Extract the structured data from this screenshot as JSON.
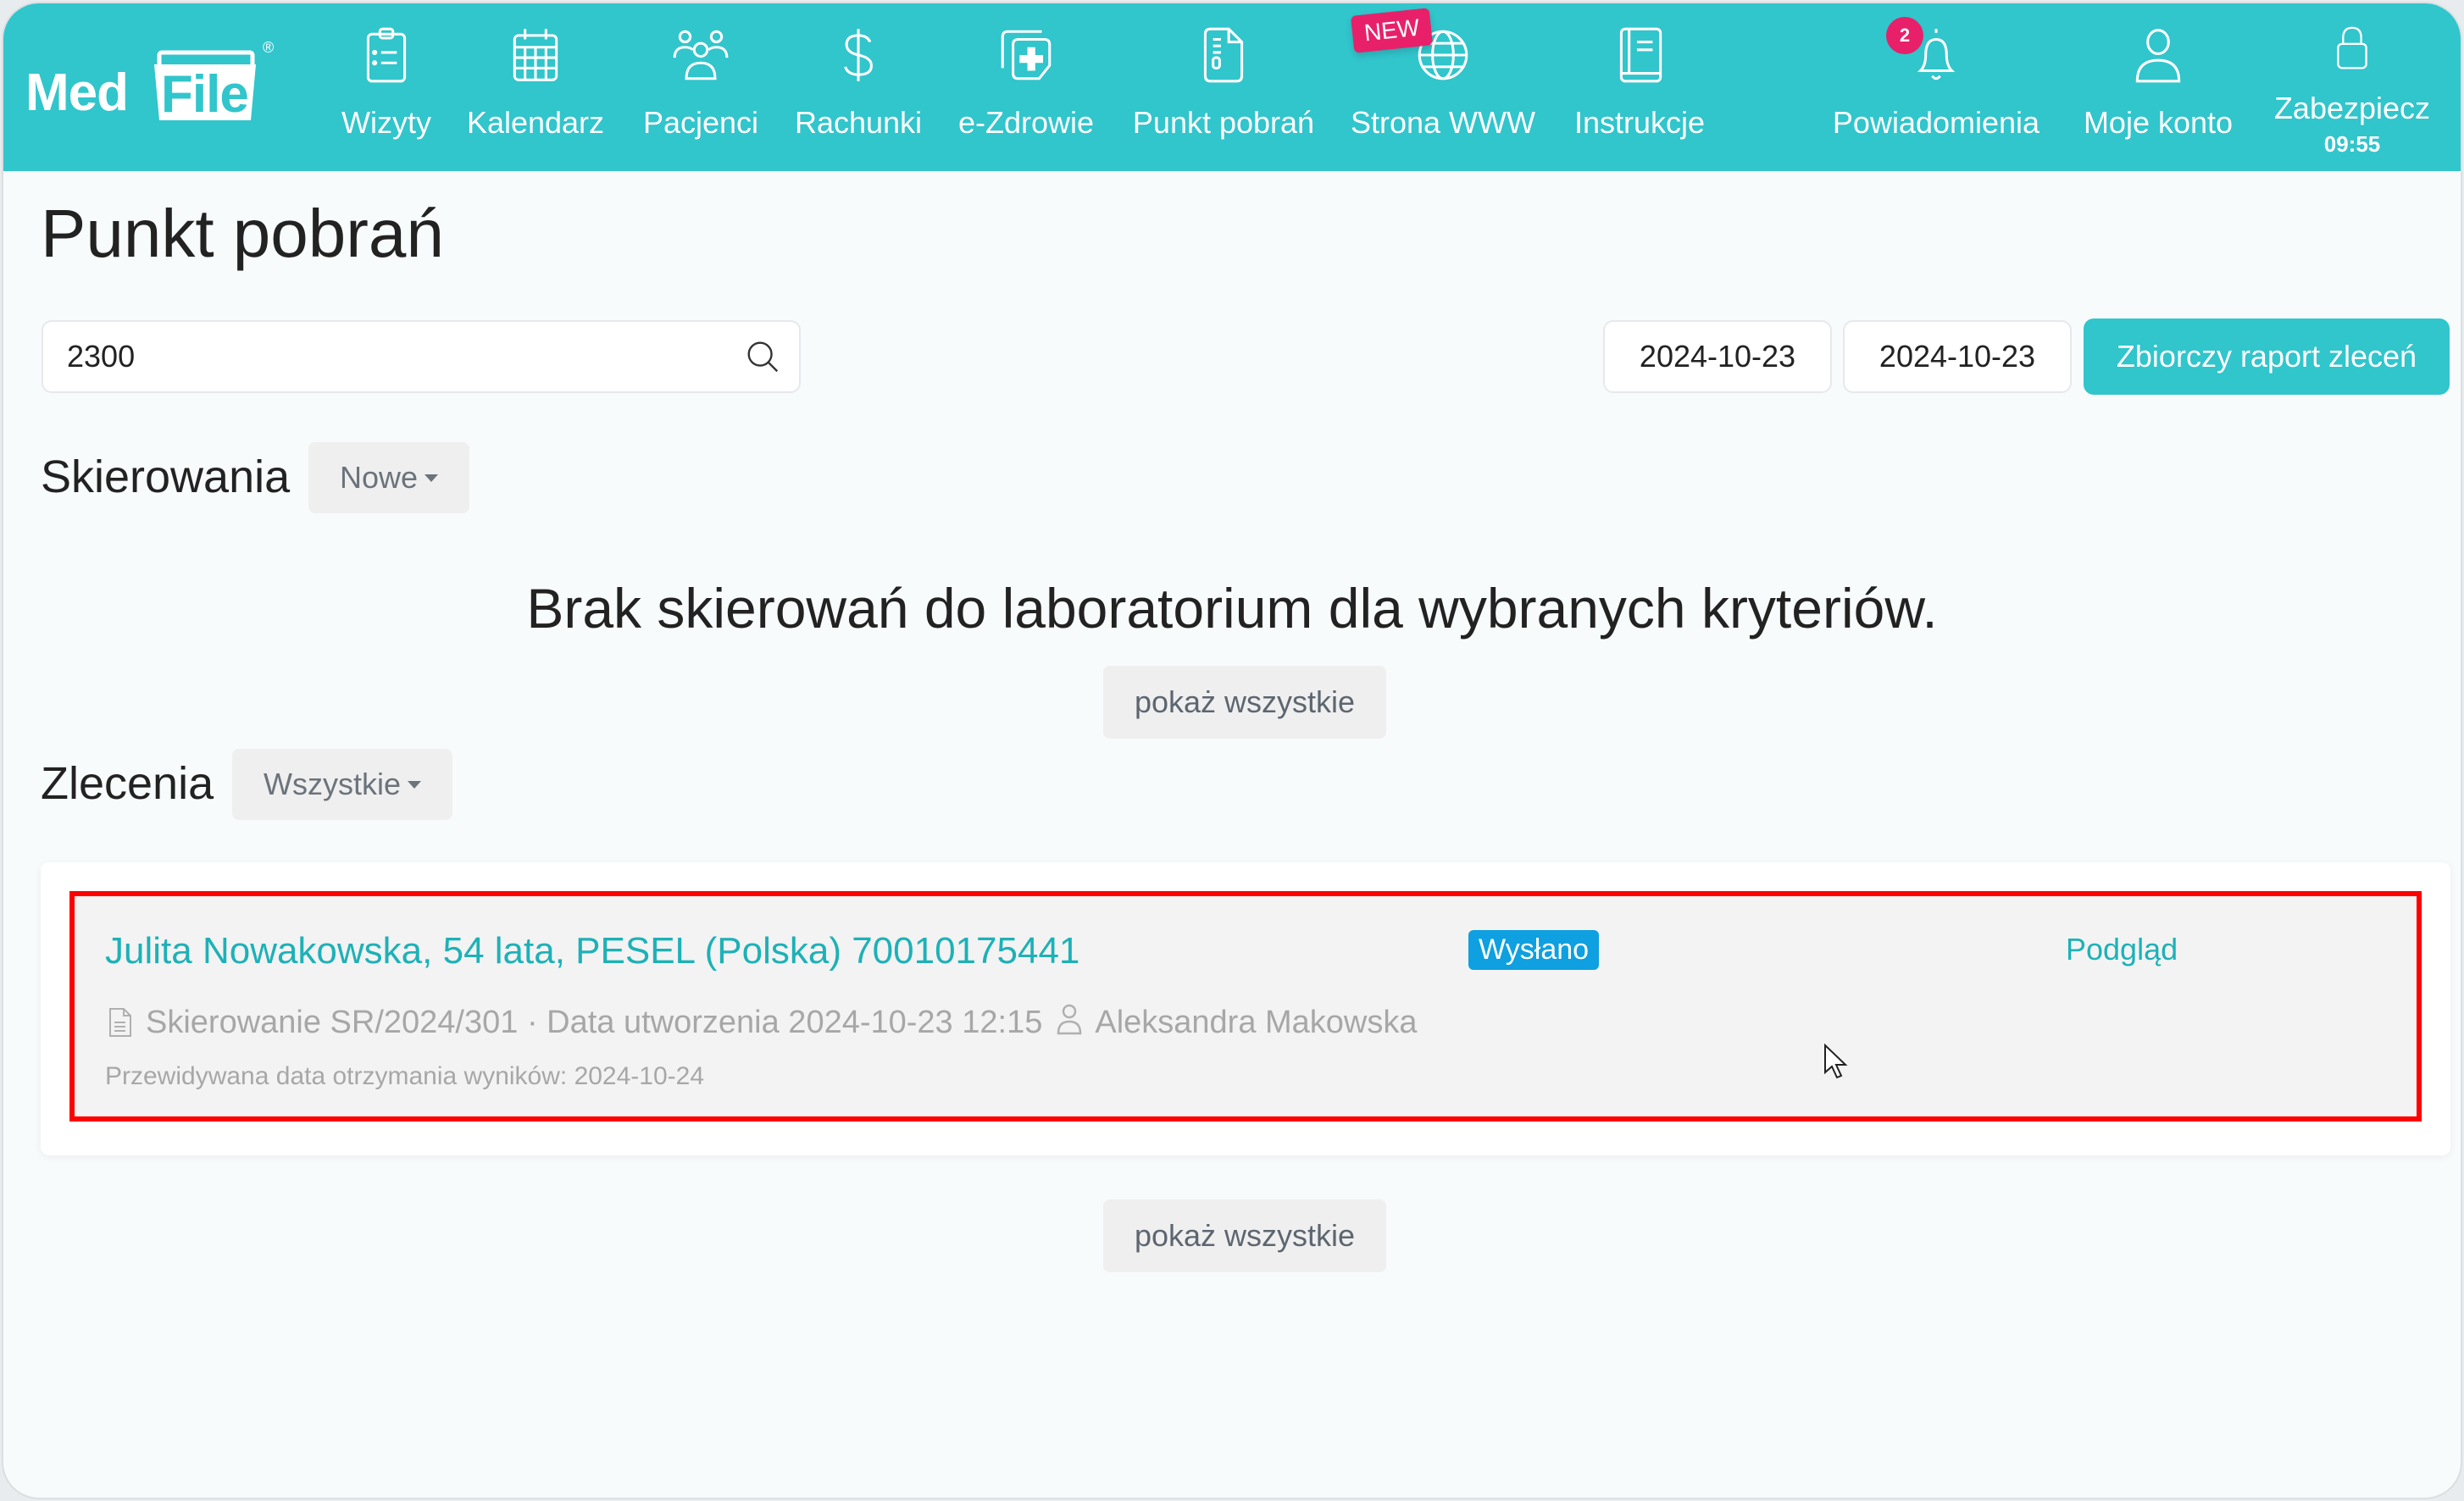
{
  "app": {
    "logo_left": "Med",
    "logo_right": "File",
    "logo_mark": "®"
  },
  "nav": {
    "items": [
      {
        "label": "Wizyty",
        "icon": "clipboard-icon"
      },
      {
        "label": "Kalendarz",
        "icon": "calendar-icon"
      },
      {
        "label": "Pacjenci",
        "icon": "patients-icon"
      },
      {
        "label": "Rachunki",
        "icon": "dollar-icon"
      },
      {
        "label": "e-Zdrowie",
        "icon": "ehealth-icon"
      },
      {
        "label": "Punkt pobrań",
        "icon": "sample-document-icon"
      },
      {
        "label": "Strona WWW",
        "icon": "globe-icon",
        "badge": "NEW"
      },
      {
        "label": "Instrukcje",
        "icon": "book-icon"
      },
      {
        "label": "Powiadomienia",
        "icon": "bell-icon",
        "count": "2"
      },
      {
        "label": "Moje konto",
        "icon": "user-icon"
      },
      {
        "label": "Zabezpiecz",
        "icon": "lock-icon",
        "timer": "09:55"
      }
    ]
  },
  "page": {
    "title": "Punkt pobrań"
  },
  "filters": {
    "search_value": "2300",
    "date_from": "2024-10-23",
    "date_to": "2024-10-23",
    "report_button": "Zbiorczy raport zleceń"
  },
  "referrals": {
    "title": "Skierowania",
    "filter_selected": "Nowe",
    "empty_message": "Brak skierowań do laboratorium dla wybranych kryteriów.",
    "show_all": "pokaż wszystkie"
  },
  "orders": {
    "title": "Zlecenia",
    "filter_selected": "Wszystkie",
    "show_all": "pokaż wszystkie",
    "items": [
      {
        "patient": "Julita Nowakowska, 54 lata, PESEL (Polska) 70010175441",
        "status": "Wysłano",
        "preview_link": "Podgląd",
        "referral": "Skierowanie SR/2024/301 · Data utworzenia 2024-10-23 12:15",
        "author": "Aleksandra Makowska",
        "expected_results": "Przewidywana data otrzymania wyników: 2024-10-24"
      }
    ]
  },
  "colors": {
    "accent": "#31c5cc",
    "link": "#1db1b7",
    "badge_new": "#e8206a",
    "status_sent": "#0ea0e0",
    "highlight_border": "#ff0000"
  }
}
